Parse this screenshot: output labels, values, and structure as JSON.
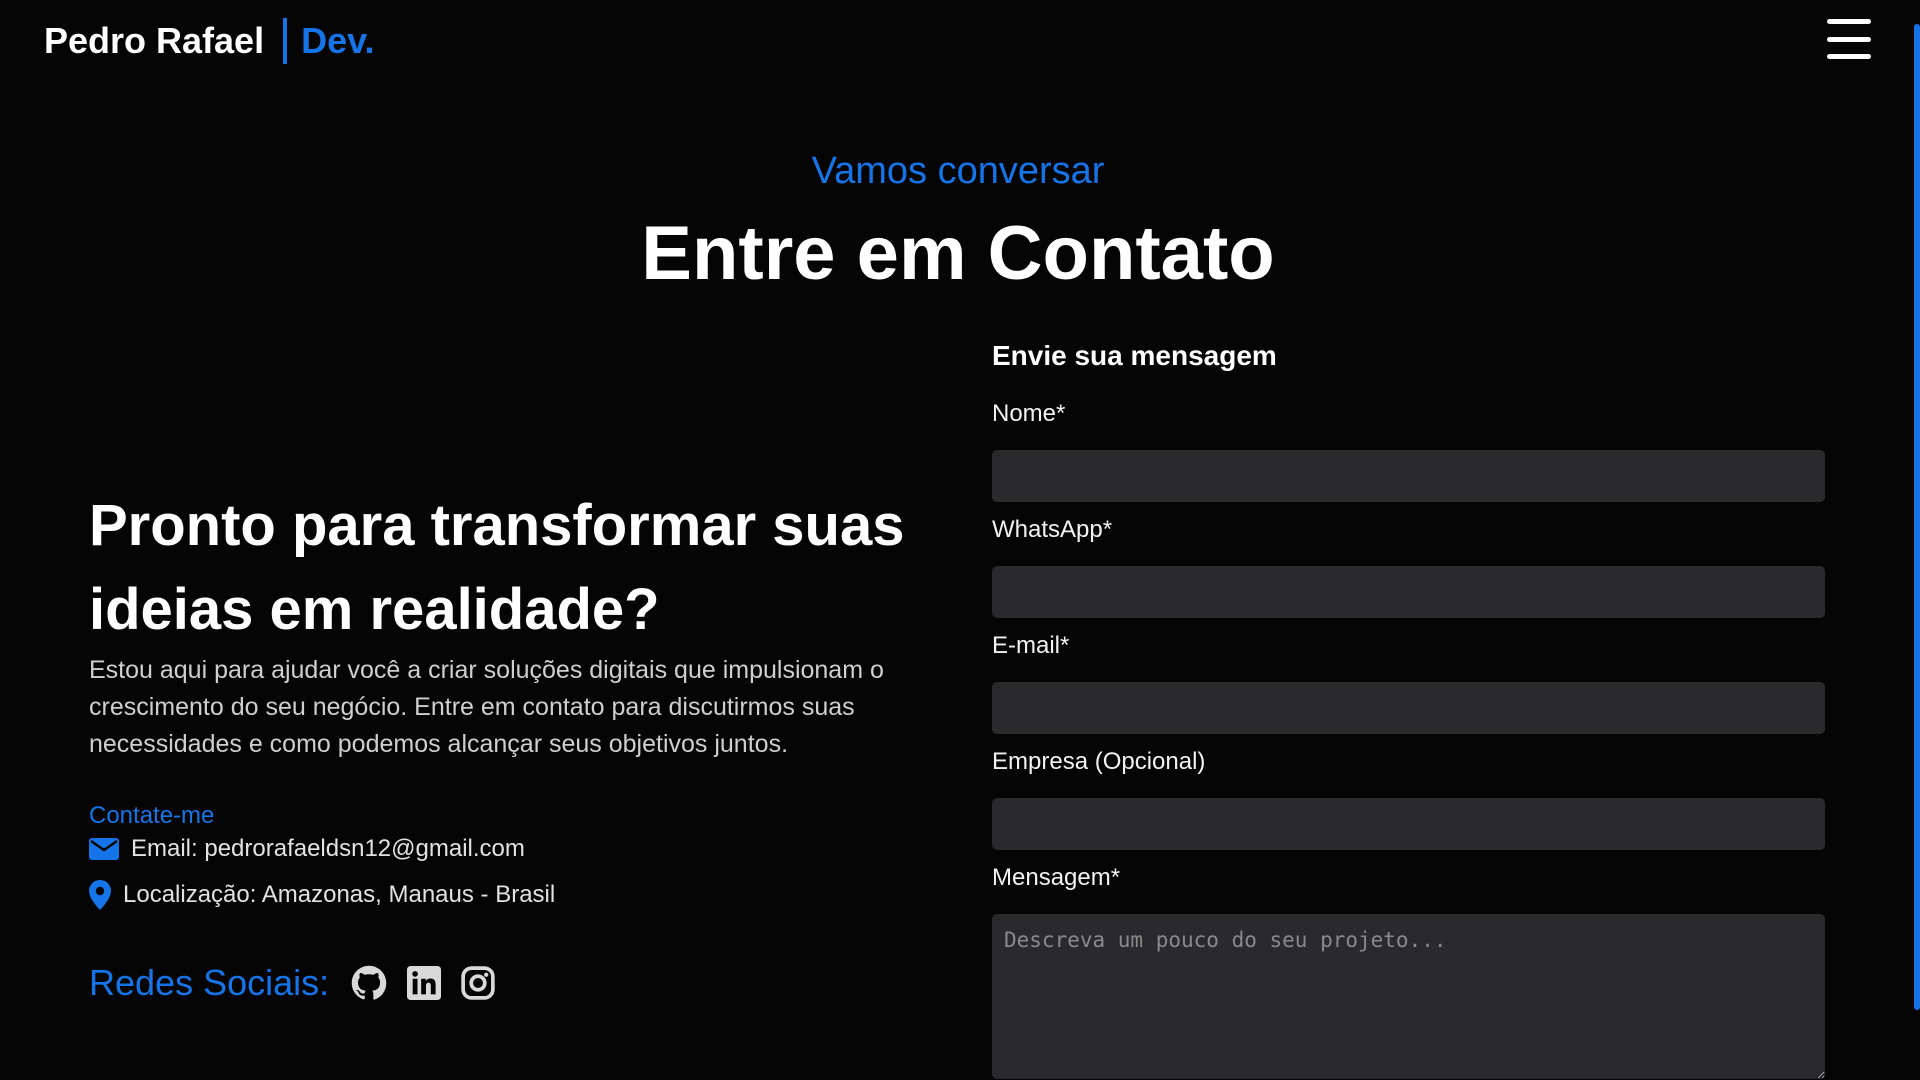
{
  "header": {
    "brand_name": "Pedro Rafael",
    "brand_suffix": "Dev.",
    "accent_color": "#1474e8"
  },
  "icons": {
    "menu": "hamburger-menu-icon",
    "email": "envelope-icon",
    "location": "map-pin-icon",
    "github": "github-icon",
    "linkedin": "linkedin-icon",
    "instagram": "instagram-icon"
  },
  "section": {
    "eyebrow": "Vamos conversar",
    "title": "Entre em Contato"
  },
  "left": {
    "pitch": "Pronto para transformar suas ideias em realidade?",
    "intro": "Estou aqui para ajudar você a criar soluções digitais que impulsionam o crescimento do seu negócio. Entre em contato para discutirmos suas necessidades e como podemos alcançar seus objetivos juntos.",
    "contact_label": "Contate-me",
    "email": "Email: pedrorafaeldsn12@gmail.com",
    "location": "Localização: Amazonas, Manaus - Brasil",
    "socials_label": "Redes Sociais:"
  },
  "form": {
    "title": "Envie sua mensagem",
    "name_label": "Nome*",
    "name_value": "",
    "whatsapp_label": "WhatsApp*",
    "whatsapp_value": "",
    "email_label": "E-mail*",
    "email_value": "",
    "company_label": "Empresa (Opcional)",
    "company_value": "",
    "message_label": "Mensagem*",
    "message_placeholder": "Descreva um pouco do seu projeto..."
  }
}
